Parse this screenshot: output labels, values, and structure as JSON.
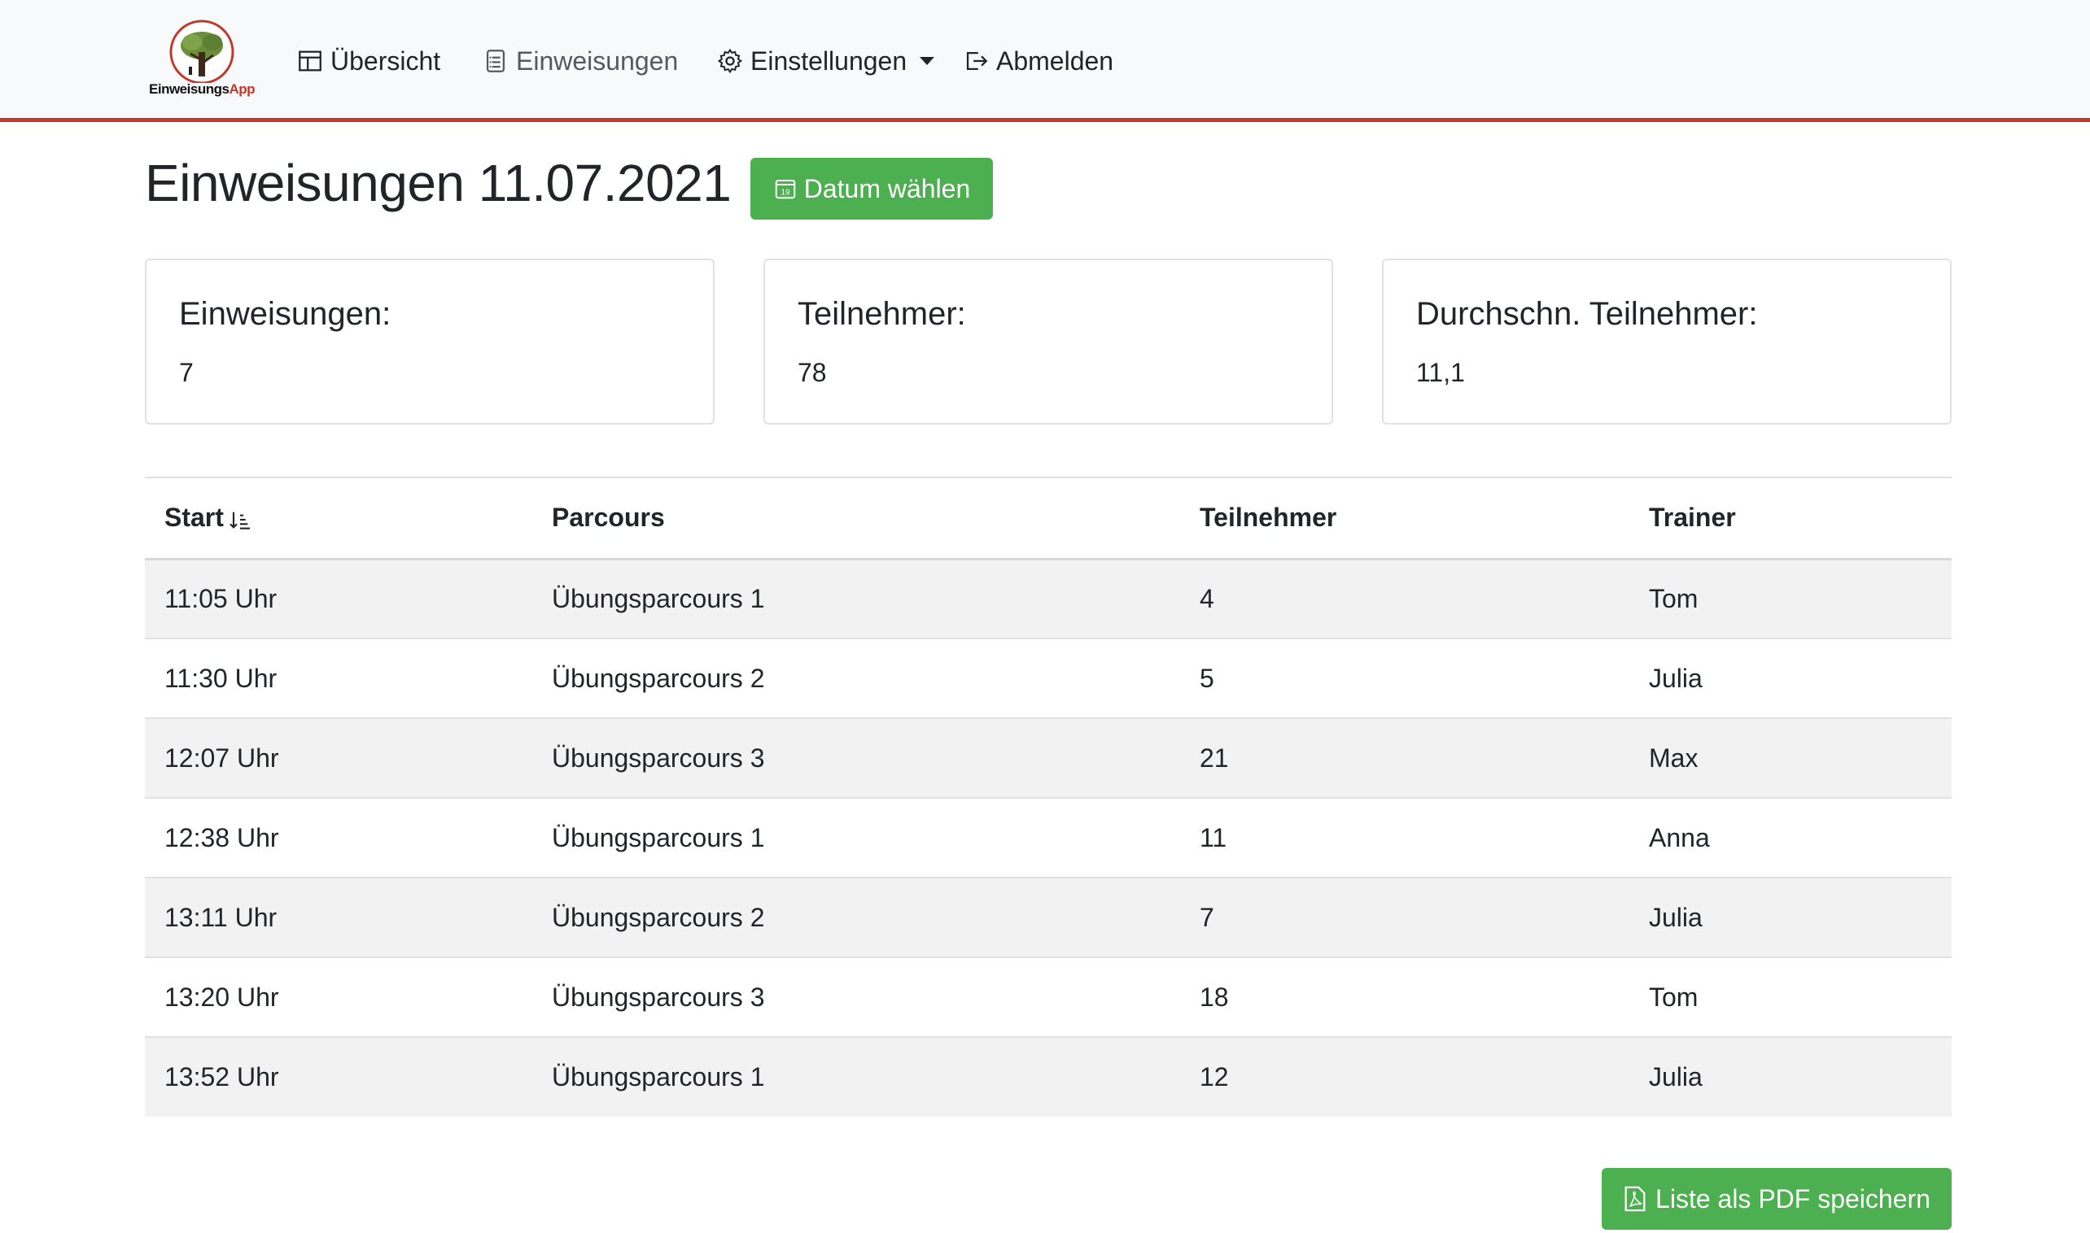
{
  "nav": {
    "logo_text_main": "Einweisungs",
    "logo_text_app": "App",
    "items": [
      {
        "label": "Übersicht"
      },
      {
        "label": "Einweisungen"
      },
      {
        "label": "Einstellungen"
      },
      {
        "label": "Abmelden"
      }
    ]
  },
  "header": {
    "title": "Einweisungen 11.07.2021",
    "date_button": "Datum wählen",
    "calendar_day": "19"
  },
  "stats": [
    {
      "title": "Einweisungen:",
      "value": "7"
    },
    {
      "title": "Teilnehmer:",
      "value": "78"
    },
    {
      "title": "Durchschn. Teilnehmer:",
      "value": "11,1"
    }
  ],
  "table": {
    "headers": [
      "Start",
      "Parcours",
      "Teilnehmer",
      "Trainer"
    ],
    "rows": [
      [
        "11:05 Uhr",
        "Übungsparcours 1",
        "4",
        "Tom"
      ],
      [
        "11:30 Uhr",
        "Übungsparcours 2",
        "5",
        "Julia"
      ],
      [
        "12:07 Uhr",
        "Übungsparcours 3",
        "21",
        "Max"
      ],
      [
        "12:38 Uhr",
        "Übungsparcours 1",
        "11",
        "Anna"
      ],
      [
        "13:11 Uhr",
        "Übungsparcours 2",
        "7",
        "Julia"
      ],
      [
        "13:20 Uhr",
        "Übungsparcours 3",
        "18",
        "Tom"
      ],
      [
        "13:52 Uhr",
        "Übungsparcours 1",
        "12",
        "Julia"
      ]
    ]
  },
  "pdf_button": "Liste als PDF speichern",
  "colors": {
    "accent_green": "#4caf50",
    "nav_border_red": "#c0392b",
    "stripe": "#f2f2f2"
  }
}
